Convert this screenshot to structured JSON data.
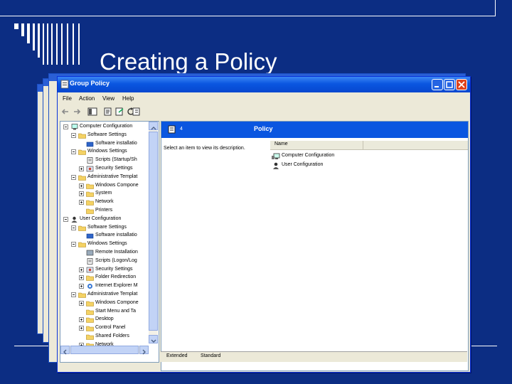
{
  "slide": {
    "title": "Creating a Policy"
  },
  "window": {
    "title": "Group Policy"
  },
  "menu": [
    "File",
    "Action",
    "View",
    "Help"
  ],
  "toolbar_icons": [
    "back-icon",
    "forward-icon",
    "console-icon",
    "properties-icon",
    "export-icon",
    "refresh-icon",
    "help-icon"
  ],
  "tree": [
    {
      "label": "Computer Configuration",
      "level": 0,
      "icon": "computer-icon",
      "expander": "minus"
    },
    {
      "label": "Software Settings",
      "level": 1,
      "icon": "folder-icon",
      "expander": "minus"
    },
    {
      "label": "Software installatio",
      "level": 2,
      "icon": "package-icon",
      "expander": ""
    },
    {
      "label": "Windows Settings",
      "level": 1,
      "icon": "folder-icon",
      "expander": "minus"
    },
    {
      "label": "Scripts (Startup/Sh",
      "level": 2,
      "icon": "script-icon",
      "expander": ""
    },
    {
      "label": "Security Settings",
      "level": 2,
      "icon": "security-icon",
      "expander": "plus"
    },
    {
      "label": "Administrative Templat",
      "level": 1,
      "icon": "folder-icon",
      "expander": "minus"
    },
    {
      "label": "Windows Compone",
      "level": 2,
      "icon": "folder-icon",
      "expander": "plus"
    },
    {
      "label": "System",
      "level": 2,
      "icon": "folder-icon",
      "expander": "plus"
    },
    {
      "label": "Network",
      "level": 2,
      "icon": "folder-icon",
      "expander": "plus"
    },
    {
      "label": "Printers",
      "level": 2,
      "icon": "folder-icon",
      "expander": ""
    },
    {
      "label": "User Configuration",
      "level": 0,
      "icon": "user-icon",
      "expander": "minus"
    },
    {
      "label": "Software Settings",
      "level": 1,
      "icon": "folder-icon",
      "expander": "minus"
    },
    {
      "label": "Software installatio",
      "level": 2,
      "icon": "package-icon",
      "expander": ""
    },
    {
      "label": "Windows Settings",
      "level": 1,
      "icon": "folder-icon",
      "expander": "minus"
    },
    {
      "label": "Remote Installation",
      "level": 2,
      "icon": "remote-icon",
      "expander": ""
    },
    {
      "label": "Scripts (Logon/Log",
      "level": 2,
      "icon": "script-icon",
      "expander": ""
    },
    {
      "label": "Security Settings",
      "level": 2,
      "icon": "security-icon",
      "expander": "plus"
    },
    {
      "label": "Folder Redirection",
      "level": 2,
      "icon": "folder-icon",
      "expander": "plus"
    },
    {
      "label": "Internet Explorer M",
      "level": 2,
      "icon": "ie-icon",
      "expander": "plus"
    },
    {
      "label": "Administrative Templat",
      "level": 1,
      "icon": "folder-icon",
      "expander": "minus"
    },
    {
      "label": "Windows Compone",
      "level": 2,
      "icon": "folder-icon",
      "expander": "plus"
    },
    {
      "label": "Start Menu and Ta",
      "level": 2,
      "icon": "folder-icon",
      "expander": ""
    },
    {
      "label": "Desktop",
      "level": 2,
      "icon": "folder-icon",
      "expander": "plus"
    },
    {
      "label": "Control Panel",
      "level": 2,
      "icon": "folder-icon",
      "expander": "plus"
    },
    {
      "label": "Shared Folders",
      "level": 2,
      "icon": "folder-icon",
      "expander": ""
    },
    {
      "label": "Network",
      "level": 2,
      "icon": "folder-icon",
      "expander": "plus"
    }
  ],
  "right_pane": {
    "header_number": "4",
    "header_title": "Policy",
    "description": "Select an item to view its description.",
    "column": "Name",
    "items": [
      "Computer Configuration",
      "User Configuration"
    ]
  },
  "tabs": [
    "Extended",
    "Standard"
  ],
  "colors": {
    "slide_background": "#0c2d83",
    "titlebar": "#0a56e0",
    "window_face": "#ece9d8"
  }
}
